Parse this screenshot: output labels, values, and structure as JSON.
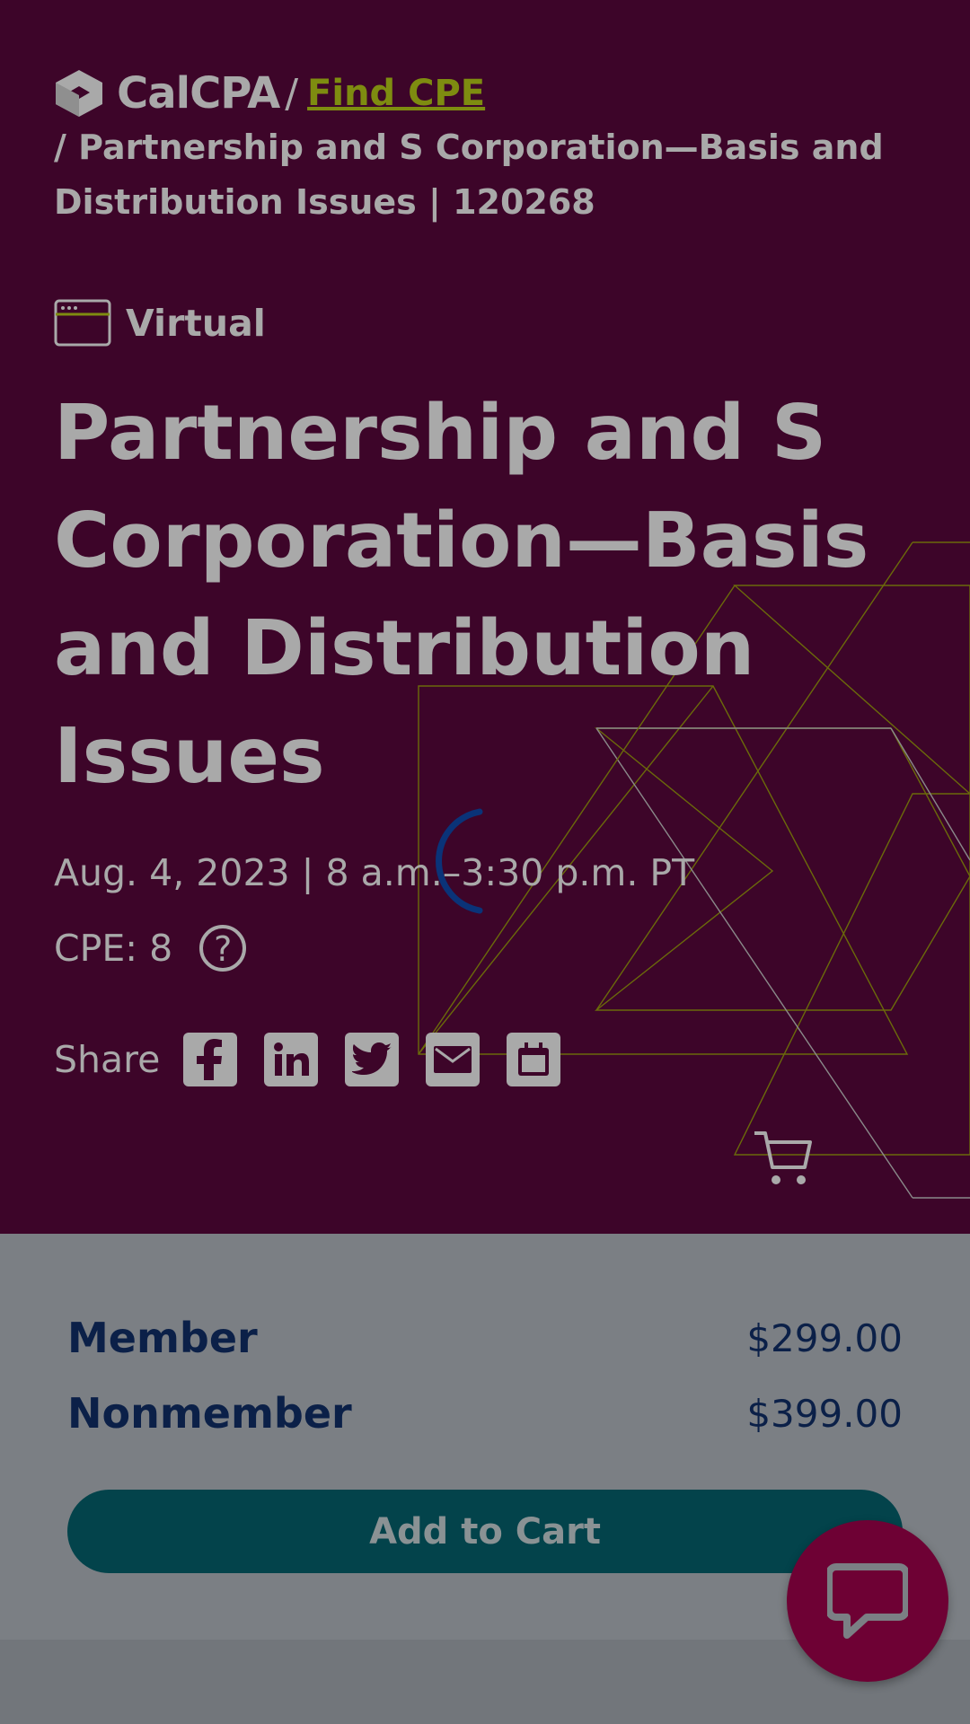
{
  "breadcrumb": {
    "brand": "CalCPA",
    "separator": "/",
    "link_label": "Find CPE",
    "current": "/ Partnership and S Corporation—Basis and Distribution Issues | 120268"
  },
  "event": {
    "format": "Virtual",
    "title": "Partnership and S Corporation—Basis and Distribution Issues",
    "date_time": "Aug. 4, 2023 | 8 a.m.–3:30 p.m. PT",
    "cpe_label": "CPE: 8",
    "help_glyph": "?"
  },
  "share": {
    "label": "Share",
    "buttons": [
      "facebook-icon",
      "linkedin-icon",
      "twitter-icon",
      "email-icon",
      "calendar-icon"
    ]
  },
  "pricing": {
    "rows": [
      {
        "name": "Member",
        "price": "$299.00"
      },
      {
        "name": "Nonmember",
        "price": "$399.00"
      }
    ],
    "cta_label": "Add to Cart"
  },
  "colors": {
    "hero_bg": "#3d0529",
    "accent_link": "#7e8c10",
    "cta_bg": "#03434b",
    "chat_bg": "#6e0134",
    "price_text": "#0b2048"
  },
  "icons": {
    "cart": "shopping-cart-icon",
    "chat": "chat-bubble-icon",
    "loading": "loading-spinner-icon"
  }
}
